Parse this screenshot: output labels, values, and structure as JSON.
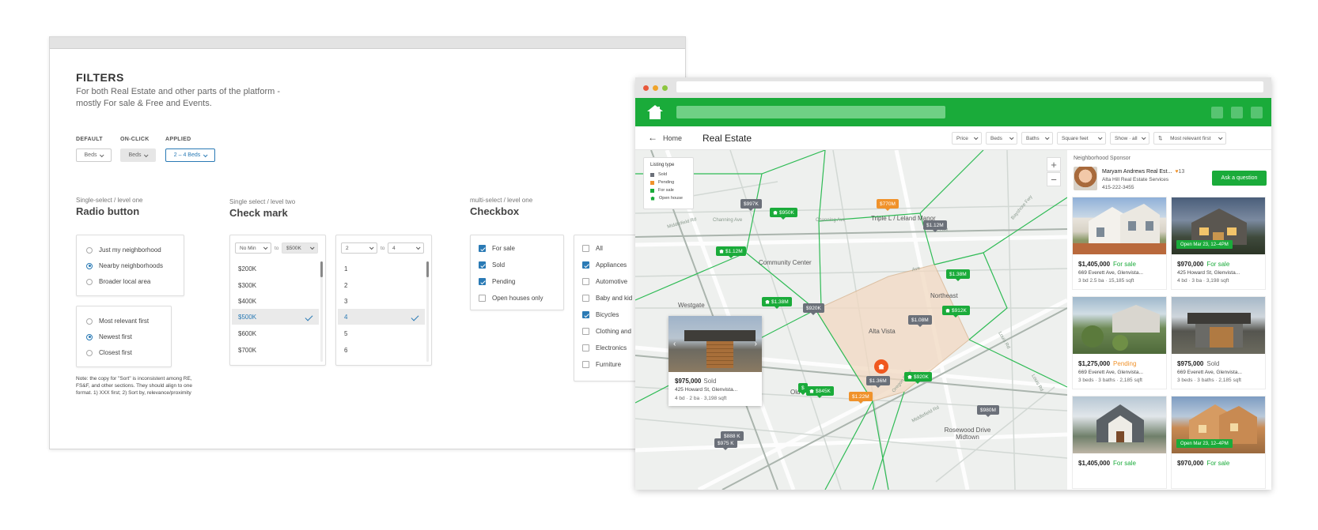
{
  "colors": {
    "accent_green": "#1aab3a",
    "select_blue": "#2a7ab5",
    "sold_grey": "#6b7079",
    "pending_orange": "#f0922b",
    "home_marker": "#f0581f"
  },
  "filters": {
    "title": "FILTERS",
    "subtitle": "For both Real Estate and other parts of the platform - mostly For sale & Free and Events.",
    "states": [
      {
        "label": "DEFAULT",
        "button": "Beds"
      },
      {
        "label": "ON-CLICK",
        "button": "Beds"
      },
      {
        "label": "APPLIED",
        "button": "2 – 4 Beds"
      }
    ],
    "radio": {
      "kicker": "Single-select / level one",
      "title": "Radio button",
      "group1": [
        {
          "label": "Just my neighborhood",
          "selected": false
        },
        {
          "label": "Nearby neighborhoods",
          "selected": true
        },
        {
          "label": "Broader local area",
          "selected": false
        }
      ],
      "group2": [
        {
          "label": "Most relevant first",
          "selected": false
        },
        {
          "label": "Newest first",
          "selected": true
        },
        {
          "label": "Closest first",
          "selected": false
        }
      ],
      "note": "Note: the copy for \"Sort\" is inconsistent among RE, FS&F, and other sections. They should align to one format. 1) XXX first; 2) Sort by, relevance/proximity"
    },
    "checkmark": {
      "kicker": "Single select / level two",
      "title": "Check mark",
      "price": {
        "min": "No Min",
        "to": "to",
        "max": "$500K",
        "options": [
          "$200K",
          "$300K",
          "$400K",
          "$500K",
          "$600K",
          "$700K"
        ],
        "selected_index": 3
      },
      "beds": {
        "min": "2",
        "to": "to",
        "max": "4",
        "options": [
          "1",
          "2",
          "3",
          "4",
          "5",
          "6"
        ],
        "selected_index": 3
      }
    },
    "checkbox": {
      "kicker": "multi-select / level one",
      "title": "Checkbox",
      "group1": [
        {
          "label": "For sale",
          "checked": true
        },
        {
          "label": "Sold",
          "checked": true
        },
        {
          "label": "Pending",
          "checked": true
        },
        {
          "label": "Open houses only",
          "checked": false
        }
      ],
      "group2": [
        {
          "label": "All",
          "checked": false
        },
        {
          "label": "Appliances",
          "checked": true
        },
        {
          "label": "Automotive",
          "checked": false
        },
        {
          "label": "Baby and kid",
          "checked": false
        },
        {
          "label": "Bicycles",
          "checked": true
        },
        {
          "label": "Clothing and",
          "checked": false
        },
        {
          "label": "Electronics",
          "checked": false
        },
        {
          "label": "Furniture",
          "checked": false
        }
      ]
    }
  },
  "app": {
    "breadcrumb_home": "Home",
    "page_title": "Real Estate",
    "filters": [
      "Price",
      "Beds",
      "Baths",
      "Square feet",
      "Show · all",
      "Most relevant first"
    ],
    "legend": {
      "title": "Listing type",
      "items": [
        {
          "label": "Sold",
          "color": "#6b7079"
        },
        {
          "label": "Pending",
          "color": "#f0922b"
        },
        {
          "label": "For sale",
          "color": "#1aab3a"
        },
        {
          "label": "Open house",
          "color": "#1aab3a"
        }
      ]
    },
    "map_labels": {
      "triple_l": "Triple L / Leland Manor",
      "community_center": "Community Center",
      "northeast": "Northeast",
      "westgate": "Westgate",
      "alta_vista": "Alta Vista",
      "old": "Old",
      "rosewood": "Rosewood Drive Midtown"
    },
    "streets": {
      "channing_1": "Channing Ave",
      "channing_2": "Channing Ave",
      "middlefield_1": "Middlefield Rd",
      "middlefield_2": "Middlefield Rd",
      "louis_1": "Louis Rd",
      "louis_2": "Louis Rd",
      "bayshore": "Bayshore Fwy",
      "oregon": "Oregon Expy",
      "ave": "Ave",
      "ave2": "Ave"
    },
    "pins": {
      "p997": "$997K",
      "p950": "$950K",
      "p770": "$770M",
      "p112a": "$1.12M",
      "p112b": "$1.12M",
      "p138a": "$1.38M",
      "p138b": "$1.38M",
      "p920": "$920K",
      "p912": "$912K",
      "p108": "$1.08M",
      "p136": "$1.36M",
      "p920b": "$920K",
      "p122": "$1.22M",
      "p845": "$845K",
      "pS": "$",
      "p980": "$980M",
      "p888": "$888 K",
      "p975": "$975 K"
    },
    "popup": {
      "price": "$975,000",
      "status": "Sold",
      "address": "425 Howard St, Glenvista...",
      "meta": "4 bd · 2 ba · 3,198 sqft"
    },
    "sponsor": {
      "kicker": "Neighborhood Sponsor",
      "name": "Maryam Andrews Real Est...",
      "likes": "13",
      "company": "Alta Hill Real Estate Services",
      "phone": "415-222-3455",
      "cta": "Ask a question"
    },
    "listings": [
      {
        "price": "$1,405,000",
        "status": "For sale",
        "address": "669 Everett Ave, Glenvista...",
        "meta": "3 bd 2.5 ba · 15,185 sqft",
        "badge": ""
      },
      {
        "price": "$970,000",
        "status": "For sale",
        "address": "425 Howard St, Glenvista...",
        "meta": "4 bd · 3 ba · 3,198 sqft",
        "badge": "Open Mar 23, 12–4PM"
      },
      {
        "price": "$1,275,000",
        "status": "Pending",
        "address": "669 Everett Ave, Glenvista...",
        "meta": "3 beds · 3 baths · 2,185 sqft",
        "badge": ""
      },
      {
        "price": "$975,000",
        "status": "Sold",
        "address": "669 Everett Ave, Glenvista...",
        "meta": "3 beds · 3 baths · 2,185 sqft",
        "badge": ""
      },
      {
        "price": "$1,405,000",
        "status": "For sale",
        "address": "",
        "meta": "",
        "badge": ""
      },
      {
        "price": "$970,000",
        "status": "For sale",
        "address": "",
        "meta": "",
        "badge": "Open Mar 23, 12–4PM"
      }
    ]
  }
}
